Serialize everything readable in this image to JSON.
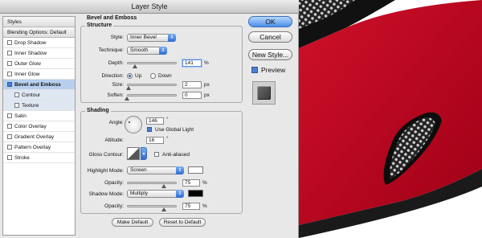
{
  "window": {
    "title": "Layer Style"
  },
  "styles_list": {
    "items": [
      {
        "label": "Styles",
        "checkbox": false,
        "state": "header"
      },
      {
        "label": "Blending Options: Default",
        "checkbox": false,
        "state": "header"
      },
      {
        "label": "Drop Shadow",
        "checkbox": true,
        "checked": false
      },
      {
        "label": "Inner Shadow",
        "checkbox": true,
        "checked": false
      },
      {
        "label": "Outer Glow",
        "checkbox": true,
        "checked": false
      },
      {
        "label": "Inner Glow",
        "checkbox": true,
        "checked": false
      },
      {
        "label": "Bevel and Emboss",
        "checkbox": true,
        "checked": true,
        "state": "selected"
      },
      {
        "label": "Contour",
        "checkbox": true,
        "checked": false,
        "state": "sub"
      },
      {
        "label": "Texture",
        "checkbox": true,
        "checked": false,
        "state": "sub"
      },
      {
        "label": "Satin",
        "checkbox": true,
        "checked": false
      },
      {
        "label": "Color Overlay",
        "checkbox": true,
        "checked": false
      },
      {
        "label": "Gradient Overlay",
        "checkbox": true,
        "checked": false
      },
      {
        "label": "Pattern Overlay",
        "checkbox": true,
        "checked": false
      },
      {
        "label": "Stroke",
        "checkbox": true,
        "checked": false
      }
    ]
  },
  "bevel": {
    "section_title": "Bevel and Emboss",
    "structure": {
      "title": "Structure",
      "style_label": "Style:",
      "style_value": "Inner Bevel",
      "technique_label": "Technique:",
      "technique_value": "Smooth",
      "depth_label": "Depth:",
      "depth_value": "141",
      "depth_unit": "%",
      "depth_level": 0.15,
      "direction_label": "Direction:",
      "direction_up": "Up",
      "direction_down": "Down",
      "direction_selected": "Up",
      "size_label": "Size:",
      "size_value": "2",
      "size_unit": "px",
      "size_level": 0.02,
      "soften_label": "Soften:",
      "soften_value": "0",
      "soften_unit": "px",
      "soften_level": 0.0
    },
    "shading": {
      "title": "Shading",
      "angle_label": "Angle:",
      "angle_value": "146",
      "angle_unit": "°",
      "global_light_label": "Use Global Light",
      "global_light_checked": true,
      "altitude_label": "Altitude:",
      "altitude_value": "16",
      "altitude_unit": "°",
      "gloss_label": "Gloss Contour:",
      "anti_aliased_label": "Anti-aliased",
      "anti_aliased_checked": false,
      "highlight_mode_label": "Highlight Mode:",
      "highlight_mode_value": "Screen",
      "highlight_color": "#ffffff",
      "highlight_opacity_label": "Opacity:",
      "highlight_opacity_value": "75",
      "highlight_opacity_unit": "%",
      "highlight_opacity_level": 0.75,
      "shadow_mode_label": "Shadow Mode:",
      "shadow_mode_value": "Multiply",
      "shadow_color": "#000000",
      "shadow_opacity_label": "Opacity:",
      "shadow_opacity_value": "75",
      "shadow_opacity_unit": "%",
      "shadow_opacity_level": 0.75
    },
    "make_default_label": "Make Default",
    "reset_default_label": "Reset to Default"
  },
  "actions": {
    "ok_label": "OK",
    "cancel_label": "Cancel",
    "new_style_label": "New Style...",
    "preview_label": "Preview",
    "preview_checked": true
  },
  "colors": {
    "accent": "#3d7be0",
    "artwork_red": "#d0102a"
  }
}
